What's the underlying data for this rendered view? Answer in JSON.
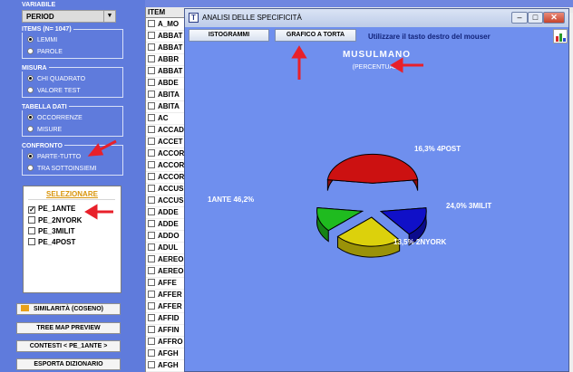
{
  "sidebar": {
    "variabile_label": "VARIABILE",
    "variabile_value": "PERIOD",
    "items_label": "ITEMS (N= 1047)",
    "items_options": [
      "LEMMI",
      "PAROLE"
    ],
    "misura_label": "MISURA",
    "misura_options": [
      "CHI QUADRATO",
      "VALORE TEST"
    ],
    "tabella_label": "TABELLA DATI",
    "tabella_options": [
      "OCCORRENZE",
      "MISURE"
    ],
    "confronto_label": "CONFRONTO",
    "confronto_options": [
      "PARTE-TUTTO",
      "TRA SOTTOINSIEMI"
    ],
    "selezionare_label": "SELEZIONARE",
    "subsets": [
      {
        "label": "PE_1ANTE",
        "checked": true
      },
      {
        "label": "PE_2NYORK",
        "checked": false
      },
      {
        "label": "PE_3MILIT",
        "checked": false
      },
      {
        "label": "PE_4POST",
        "checked": false
      }
    ],
    "buttons": [
      "SIMILARITÀ (COSENO)",
      "TREE MAP PREVIEW",
      "CONTESTI < PE_1ANTE >",
      "ESPORTA DIZIONARIO"
    ]
  },
  "item_list": {
    "header": "ITEM",
    "rows": [
      "A_MO",
      "ABBAT",
      "ABBAT",
      "ABBR",
      "ABBAT",
      "ABDE",
      "ABITA",
      "ABITA",
      "AC",
      "ACCAD",
      "ACCET",
      "ACCOR",
      "ACCOR",
      "ACCOR",
      "ACCUS",
      "ACCUS",
      "ADDE",
      "ADDE",
      "ADDO",
      "ADUL",
      "AEREO",
      "AEREO",
      "AFFE",
      "AFFER",
      "AFFER",
      "AFFID",
      "AFFIN",
      "AFFRO",
      "AFGH",
      "AFGH"
    ]
  },
  "dialog": {
    "title": "ANALISI DELLE SPECIFICITÀ",
    "btn_istogrammi": "ISTOGRAMMI",
    "btn_grafico": "GRAFICO A TORTA",
    "hint": "Utilizzare il tasto destro del mouser",
    "chart_title": "MUSULMANO",
    "chart_subtitle": "(PERCENTUALI)"
  },
  "chart_data": {
    "type": "pie",
    "title": "MUSULMANO",
    "subtitle": "(PERCENTUALI)",
    "slices": [
      {
        "label": "1ANTE 46,2%",
        "value": 46.2,
        "color": "#cc1111"
      },
      {
        "label": "16,3% 4POST",
        "value": 16.3,
        "color": "#1010c8"
      },
      {
        "label": "24,0% 3MILIT",
        "value": 24.0,
        "color": "#dcd10c"
      },
      {
        "label": "13,5% 2NYORK",
        "value": 13.5,
        "color": "#1fbb1f"
      }
    ]
  },
  "colors": {
    "background": "#6f86e0",
    "dialog": "#6f8fee",
    "annotation_arrow": "#e8202a",
    "selezionare_header": "#d8940a"
  }
}
